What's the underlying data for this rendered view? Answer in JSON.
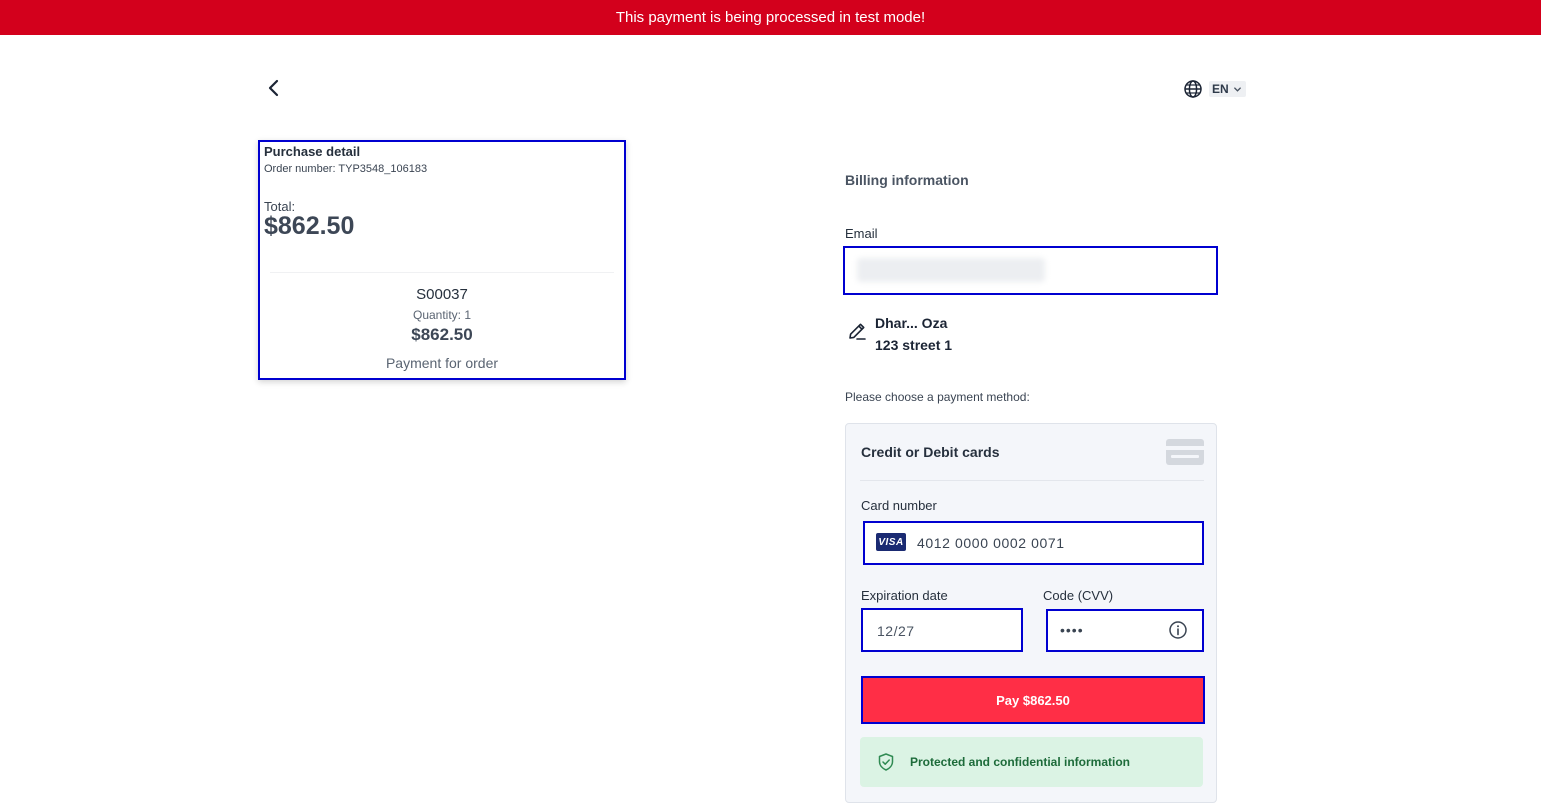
{
  "banner": {
    "text": "This payment is being processed in test mode!"
  },
  "header": {
    "language": "EN"
  },
  "purchase_detail": {
    "title": "Purchase detail",
    "order_number": "Order number: TYP3548_106183",
    "total_label": "Total:",
    "total_value": "$862.50",
    "item": {
      "name": "S00037",
      "quantity": "Quantity: 1",
      "price": "$862.50",
      "description": "Payment for order"
    }
  },
  "billing": {
    "title": "Billing information",
    "email_label": "Email",
    "email_value": "",
    "contact_name": "Dhar... Oza",
    "contact_address": "123 street 1"
  },
  "payment": {
    "choose_label": "Please choose a payment method:",
    "method_title": "Credit or Debit cards",
    "card_number_label": "Card number",
    "card_brand": "VISA",
    "card_number_value": "4012 0000 0002 0071",
    "expiration_label": "Expiration date",
    "expiration_value": "12/27",
    "cvv_label": "Code (CVV)",
    "cvv_value": "••••",
    "pay_button_label": "Pay $862.50",
    "secure_text": "Protected and confidential information"
  },
  "colors": {
    "banner": "#d3001c",
    "pay_button": "#ff2e46",
    "highlight_border": "#0000d0",
    "secure_bg": "#dbf3e4",
    "secure_text": "#1d6b3a"
  },
  "icons": {
    "back": "chevron-left-icon",
    "language": "globe-icon",
    "language_dropdown": "chevron-down-icon",
    "edit": "edit-icon",
    "card_generic": "credit-card-icon",
    "cvv_info": "info-icon",
    "secure": "shield-check-icon"
  }
}
